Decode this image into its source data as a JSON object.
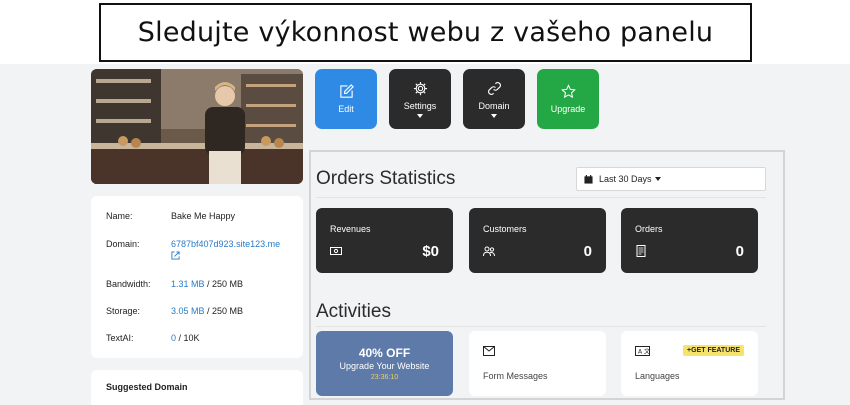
{
  "banner": {
    "title": "Sledujte výkonnost webu z vašeho panelu"
  },
  "site_info": {
    "rows": [
      {
        "label": "Name:",
        "value": "Bake Me Happy"
      },
      {
        "label": "Domain:",
        "value": "6787bf407d923.site123.me"
      },
      {
        "label": "Bandwidth:",
        "value_used": "1.31 MB",
        "value_total": " / 250 MB"
      },
      {
        "label": "Storage:",
        "value_used": "3.05 MB",
        "value_total": " / 250 MB"
      },
      {
        "label": "TextAI:",
        "value_used": "0",
        "value_total": " / 10K"
      }
    ]
  },
  "suggested_domain": {
    "title": "Suggested Domain"
  },
  "actions": [
    {
      "label": "Edit",
      "icon": "edit-icon",
      "color": "#2f8ae6"
    },
    {
      "label": "Settings",
      "icon": "gear-icon",
      "color": "#2b2b2b"
    },
    {
      "label": "Domain",
      "icon": "link-icon",
      "color": "#2b2b2b"
    },
    {
      "label": "Upgrade",
      "icon": "star-icon",
      "color": "#24a745"
    }
  ],
  "orders": {
    "title": "Orders Statistics",
    "date_range": "Last 30 Days",
    "stats": [
      {
        "label": "Revenues",
        "value": "$0",
        "icon": "money-icon"
      },
      {
        "label": "Customers",
        "value": "0",
        "icon": "users-icon"
      },
      {
        "label": "Orders",
        "value": "0",
        "icon": "receipt-icon"
      }
    ]
  },
  "activities": {
    "title": "Activities",
    "promo": {
      "headline": "40% OFF",
      "sub": "Upgrade Your Website",
      "timer": "23:36:10",
      "color": "#5e7aa8"
    },
    "form_messages": {
      "label": "Form Messages",
      "icon": "envelope-icon"
    },
    "languages": {
      "label": "Languages",
      "badge": "+GET FEATURE",
      "icon": "translate-icon"
    }
  }
}
